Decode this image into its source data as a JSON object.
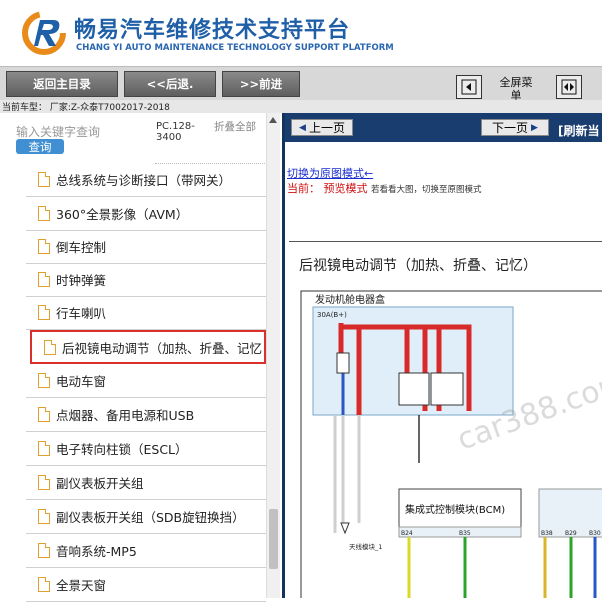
{
  "header": {
    "title": "畅易汽车维修技术支持平台",
    "subtitle": "CHANG YI AUTO MAINTENANCE TECHNOLOGY SUPPORT PLATFORM"
  },
  "toolbar": {
    "home_label": "返回主目录",
    "back_label": "<<后退.",
    "forward_label": ">>前进",
    "fullscreen_label": "全屏菜单"
  },
  "vehicle": {
    "line": "当前车型： 厂家:Z-众泰T7002017-2018"
  },
  "sidebar": {
    "search_placeholder": "输入关键字查询",
    "search_button": "查询",
    "code": "PC.128-3400",
    "fold": "折叠全部",
    "items": [
      {
        "label": "总线系统与诊断接口（带网关）"
      },
      {
        "label": "360°全景影像（AVM）"
      },
      {
        "label": "倒车控制"
      },
      {
        "label": "时钟弹簧"
      },
      {
        "label": "行车喇叭"
      },
      {
        "label": "后视镜电动调节（加热、折叠、记忆"
      },
      {
        "label": "电动车窗"
      },
      {
        "label": "点烟器、备用电源和USB"
      },
      {
        "label": "电子转向柱锁（ESCL）"
      },
      {
        "label": "副仪表板开关组"
      },
      {
        "label": "副仪表板开关组（SDB旋钮换挡）"
      },
      {
        "label": "音响系统-MP5"
      },
      {
        "label": "全景天窗"
      }
    ],
    "selected_index": 5
  },
  "content": {
    "prev_label": "上一页",
    "next_label": "下一页",
    "refresh_label": "[刷新当",
    "switch_link": "切换为原图模式←",
    "mode_prefix": "当前：",
    "mode_name": "预览模式",
    "mode_hint": "若看看大图，切换至原图模式",
    "diagram_title": "后视镜电动调节（加热、折叠、记忆）",
    "diagram": {
      "box_label": "发动机舱电器盒",
      "fuse_label": "30A(B+)",
      "bcm_label": "集成式控制模块(BCM)",
      "antenna_label": "天线模块_1",
      "pins": [
        "B24",
        "B35",
        "B38",
        "B29",
        "B30"
      ],
      "watermark": "car388.com"
    }
  },
  "colors": {
    "brand_blue": "#1f5fa8",
    "nav_bar": "#183d6e",
    "selected_border": "#d9302c",
    "wire_red": "#d92a2a"
  }
}
